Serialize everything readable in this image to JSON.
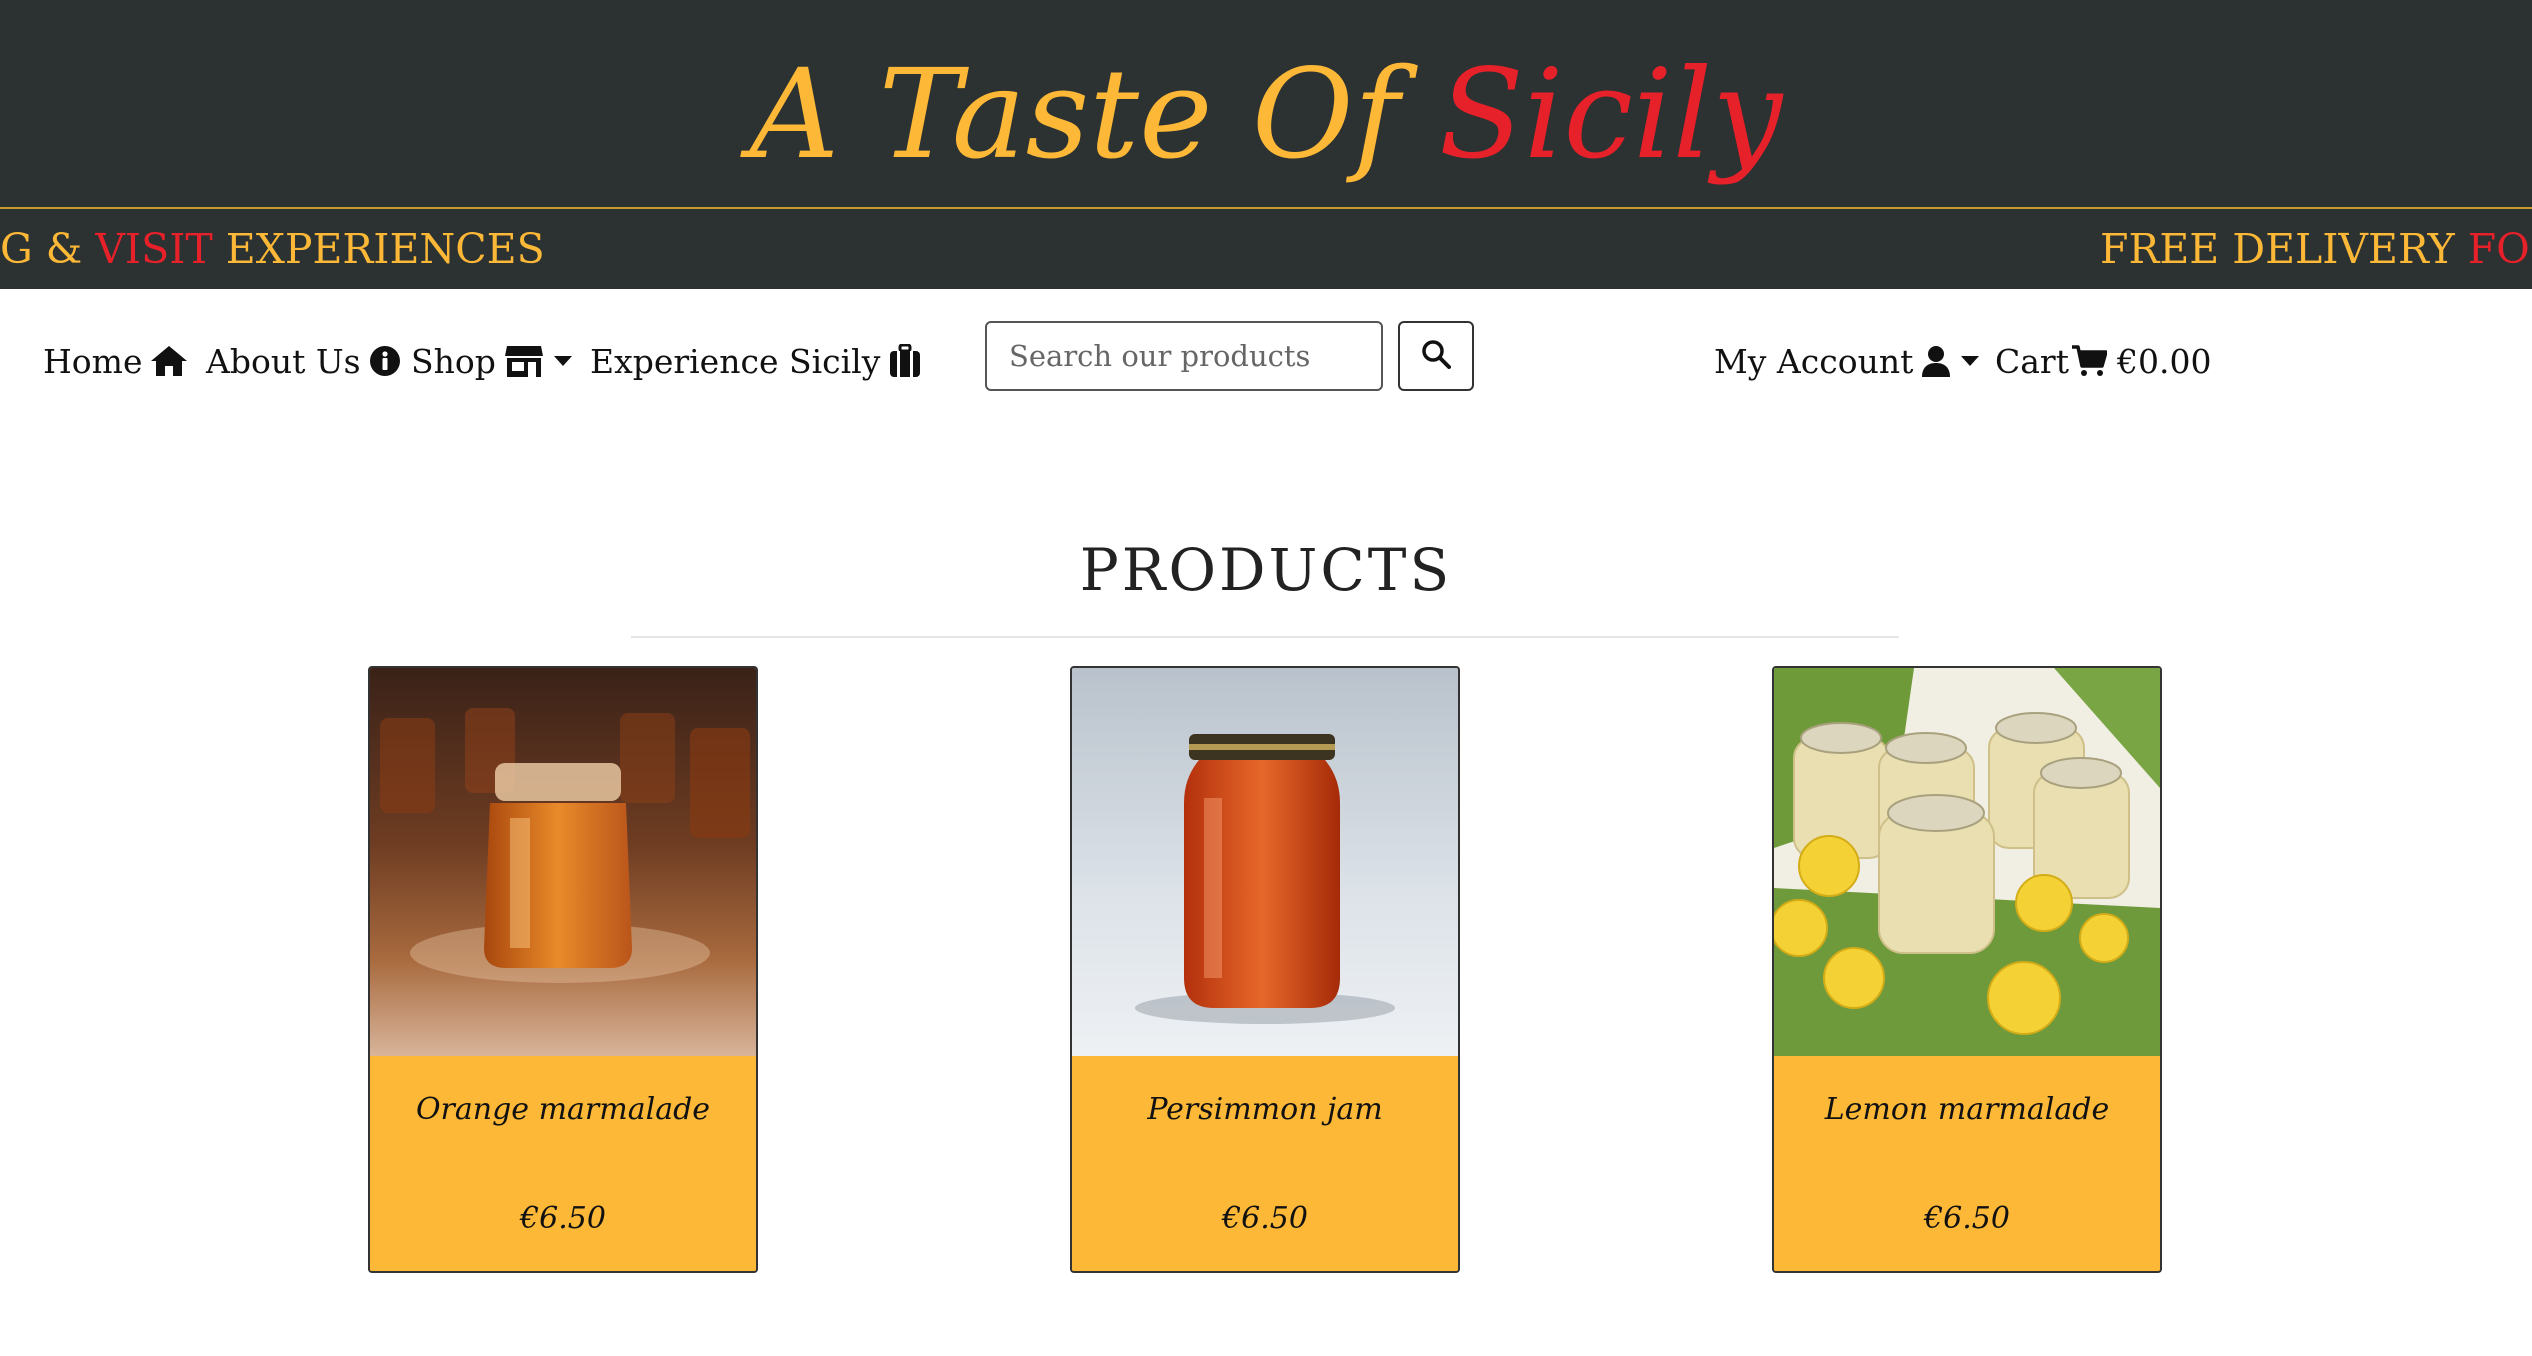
{
  "brand": {
    "logo_part1": "A Taste Of ",
    "logo_part2": "Sicily",
    "colors": {
      "yellow": "#fcb836",
      "red": "#e62129",
      "dark": "#2c3132"
    }
  },
  "ticker": {
    "left": {
      "a": "G",
      "b": " & ",
      "c": "VISIT",
      "d": " EXPERIENCES"
    },
    "right": {
      "a": "FREE DELIVERY ",
      "b": "FOR"
    }
  },
  "nav": {
    "home": "Home",
    "about": "About Us",
    "shop": "Shop",
    "experience": "Experience Sicily",
    "account": "My Account",
    "cart": "Cart",
    "cart_total": "€0.00"
  },
  "search": {
    "placeholder": "Search our products"
  },
  "page": {
    "title": "PRODUCTS"
  },
  "products": [
    {
      "name": "Orange marmalade",
      "price": "€6.50",
      "image_icon": "orange-marmalade-jar"
    },
    {
      "name": "Persimmon jam",
      "price": "€6.50",
      "image_icon": "persimmon-jam-jar"
    },
    {
      "name": "Lemon marmalade",
      "price": "€6.50",
      "image_icon": "lemon-marmalade-jars"
    }
  ]
}
